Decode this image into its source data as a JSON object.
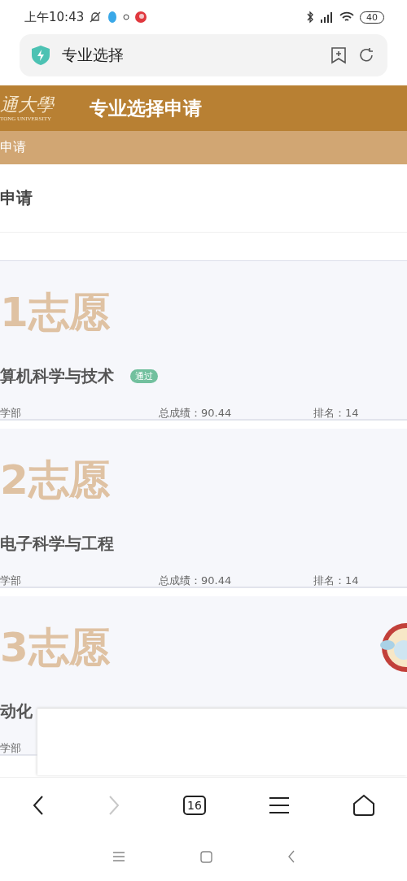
{
  "status_bar": {
    "time": "上午10:43",
    "battery": "40"
  },
  "address_bar": {
    "title": "专业选择"
  },
  "header": {
    "logo_text": "通大學",
    "logo_subtext": "TONG UNIVERSITY",
    "title": "专业选择申请"
  },
  "breadcrumb": "申请",
  "section_title": "申请",
  "choices": [
    {
      "rank_label": "1志愿",
      "major": "算机科学与技术",
      "badge": "通过",
      "department": "学部",
      "score": "总成绩：90.44",
      "ranking": "排名：14"
    },
    {
      "rank_label": "2志愿",
      "major": "电子科学与工程",
      "department": "学部",
      "score": "总成绩：90.44",
      "ranking": "排名：14"
    },
    {
      "rank_label": "3志愿",
      "major": "动化",
      "department": "学部"
    }
  ],
  "browser_nav": {
    "forward_disabled": true,
    "tab_count": "16"
  }
}
